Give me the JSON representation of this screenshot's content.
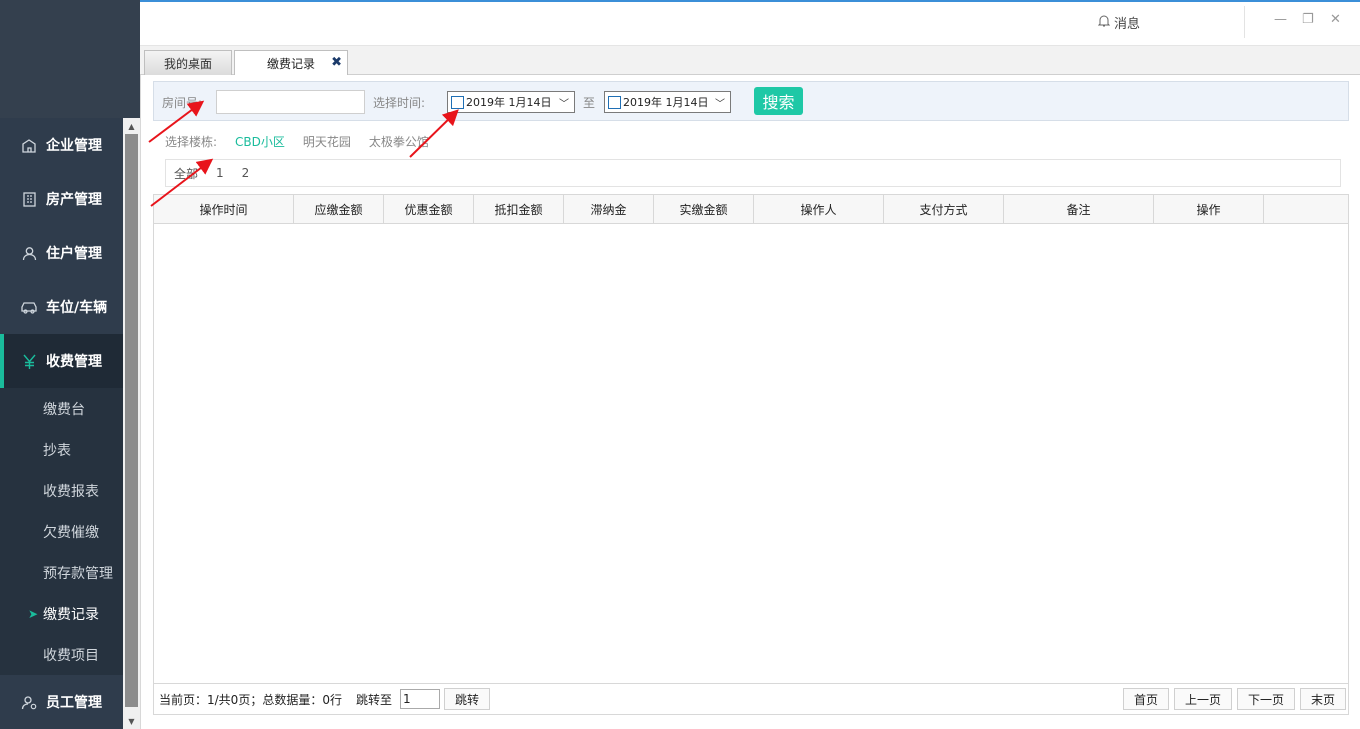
{
  "sidebar": {
    "menu": [
      {
        "label": "企业管理",
        "icon": "enterprise-icon"
      },
      {
        "label": "房产管理",
        "icon": "building-icon"
      },
      {
        "label": "住户管理",
        "icon": "resident-icon"
      },
      {
        "label": "车位/车辆",
        "icon": "car-icon"
      },
      {
        "label": "收费管理",
        "icon": "yen-icon"
      },
      {
        "label": "员工管理",
        "icon": "staff-icon"
      }
    ],
    "submenu": [
      "缴费台",
      "抄表",
      "收费报表",
      "欠费催缴",
      "预存款管理",
      "缴费记录",
      "收费项目"
    ]
  },
  "topbar": {
    "message_label": "消息"
  },
  "tabs": [
    {
      "label": "我的桌面"
    },
    {
      "label": "缴费记录"
    }
  ],
  "search": {
    "room_label": "房间号:",
    "time_label": "选择时间:",
    "date_from": "2019年  1月14日",
    "to_label": "至",
    "date_to": "2019年  1月14日",
    "search_button": "搜索"
  },
  "building": {
    "label": "选择楼栋:",
    "options": [
      "CBD小区",
      "明天花园",
      "太极拳公馆"
    ],
    "selected": "CBD小区"
  },
  "pager_top": [
    "全部",
    "1",
    "2"
  ],
  "table": {
    "columns": [
      "操作时间",
      "应缴金额",
      "优惠金额",
      "抵扣金额",
      "滞纳金",
      "实缴金额",
      "操作人",
      "支付方式",
      "备注",
      "操作"
    ],
    "rows": []
  },
  "footer": {
    "status": "当前页：1/共0页；总数据量：0行",
    "jump_label": "跳转至",
    "jump_value": "1",
    "jump_button": "跳转",
    "first": "首页",
    "prev": "上一页",
    "next": "下一页",
    "last": "末页"
  },
  "colors": {
    "accent": "#1abc9c",
    "sidebar": "#2f3c4c",
    "search_button": "#1ec8a6"
  }
}
